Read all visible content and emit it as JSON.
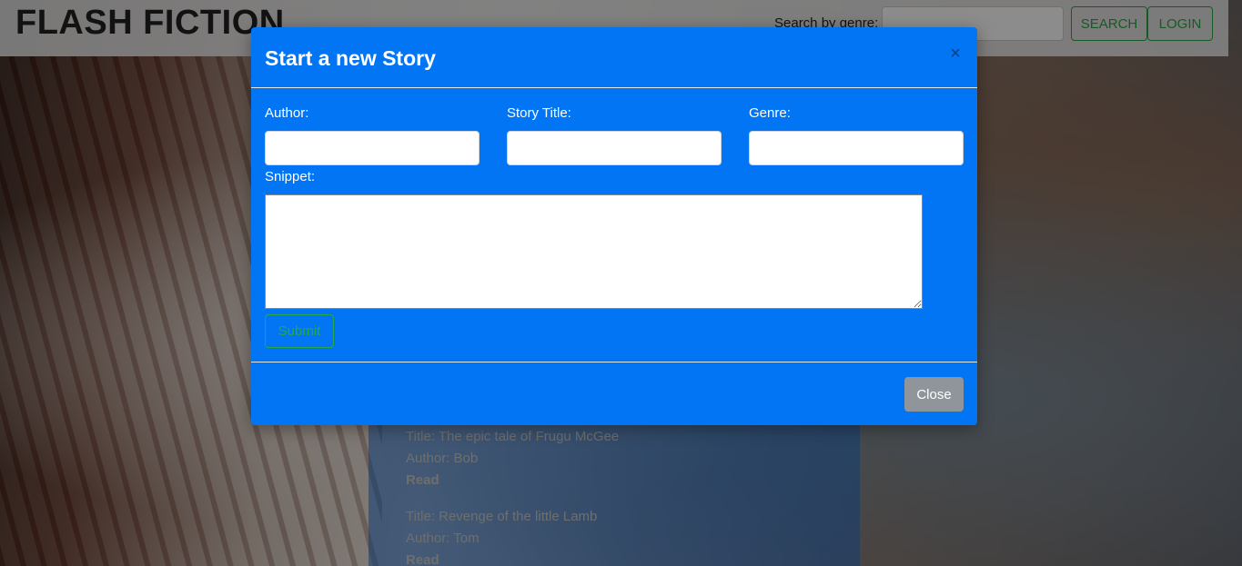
{
  "navbar": {
    "brand": "FLASH FICTION",
    "search_label": "Search by genre:",
    "search_placeholder": "",
    "search_button": "SEARCH",
    "login_button": "LOGIN"
  },
  "stories": [
    {
      "title_line": "Title: The epic tale of Frugu McGee",
      "author_line": "Author: Bob",
      "read_label": "Read"
    },
    {
      "title_line": "Title: Revenge of the little Lamb",
      "author_line": "Author: Tom",
      "read_label": "Read"
    }
  ],
  "modal": {
    "title": "Start a new Story",
    "close_icon_glyph": "×",
    "author_label": "Author:",
    "author_value": "",
    "story_title_label": "Story Title:",
    "story_title_value": "",
    "genre_label": "Genre:",
    "genre_value": "",
    "snippet_label": "Snippet:",
    "snippet_value": "",
    "submit_button": "Submit",
    "close_button": "Close"
  },
  "colors": {
    "modal_bg": "#0275f5",
    "success_green": "#28a745",
    "close_button_gray": "#8f959a"
  }
}
